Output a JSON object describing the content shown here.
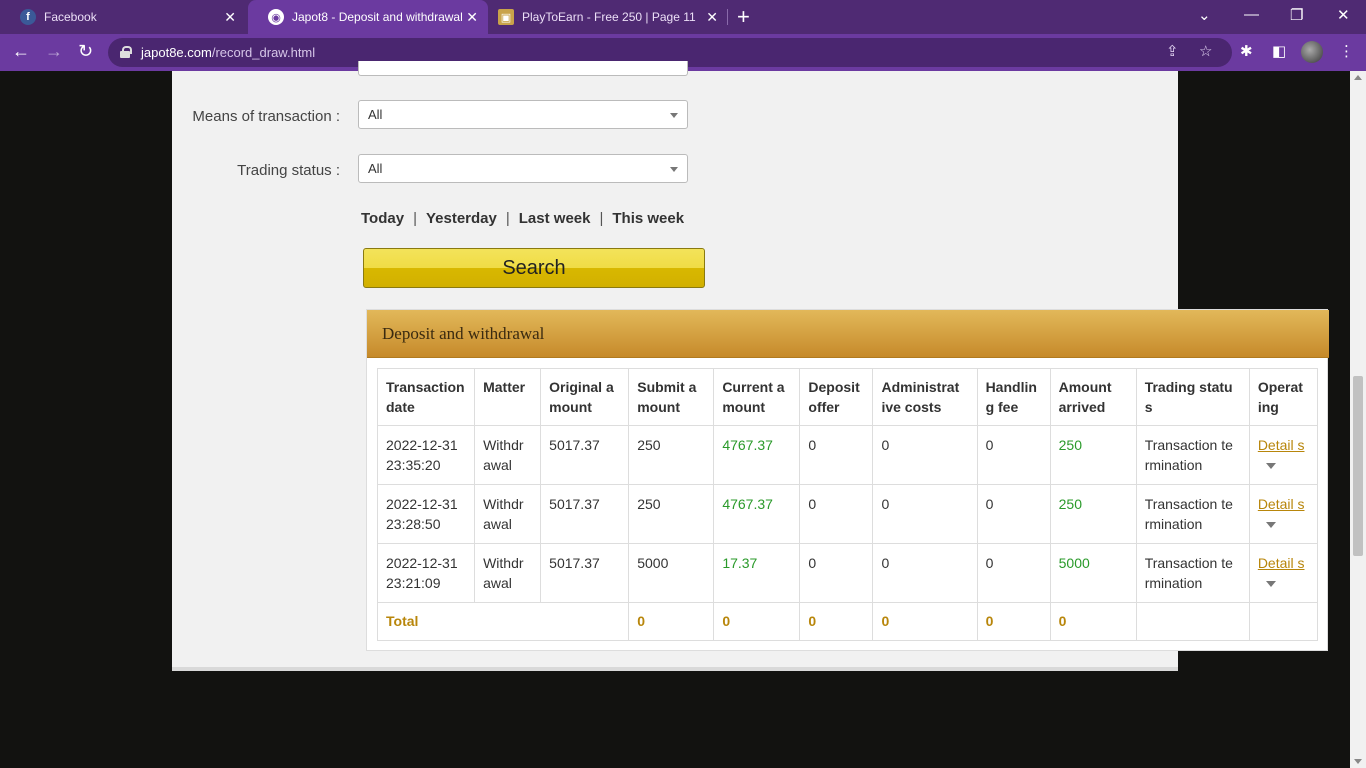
{
  "browser": {
    "tabs": [
      {
        "title": "Facebook",
        "icon": "facebook-icon"
      },
      {
        "title": "Japot8 - Deposit and withdrawal",
        "icon": "globe-icon"
      },
      {
        "title": "PlayToEarn - Free 250 | Page 11 | I",
        "icon": "cube-icon"
      }
    ],
    "url_host": "japot8e.com",
    "url_path": "/record_draw.html"
  },
  "filters": {
    "means_label": "Means of transaction :",
    "means_value": "All",
    "status_label": "Trading status :",
    "status_value": "All"
  },
  "quick_ranges": [
    "Today",
    "Yesterday",
    "Last week",
    "This week"
  ],
  "search_label": "Search",
  "section_title": "Deposit and withdrawal",
  "table": {
    "headers": [
      "Transaction date",
      "Matter",
      "Original a mount",
      "Submit a mount",
      "Current a mount",
      "Deposit offer",
      "Administrat ive costs",
      "Handlin g fee",
      "Amount arrived",
      "Trading statu s",
      "Operat ing"
    ],
    "rows": [
      {
        "date": "2022-12-31",
        "time": "23:35:20",
        "matter": "Withdr awal",
        "original": "5017.37",
        "submit": "250",
        "current": "4767.37",
        "deposit_offer": "0",
        "admin": "0",
        "fee": "0",
        "arrived": "250",
        "status": "Transaction te rmination",
        "op": "Detail s"
      },
      {
        "date": "2022-12-31",
        "time": "23:28:50",
        "matter": "Withdr awal",
        "original": "5017.37",
        "submit": "250",
        "current": "4767.37",
        "deposit_offer": "0",
        "admin": "0",
        "fee": "0",
        "arrived": "250",
        "status": "Transaction te rmination",
        "op": "Detail s"
      },
      {
        "date": "2022-12-31",
        "time": "23:21:09",
        "matter": "Withdr awal",
        "original": "5017.37",
        "submit": "5000",
        "current": "17.37",
        "deposit_offer": "0",
        "admin": "0",
        "fee": "0",
        "arrived": "5000",
        "status": "Transaction te rmination",
        "op": "Detail s"
      }
    ],
    "total": {
      "label": "Total",
      "submit": "0",
      "current": "0",
      "deposit_offer": "0",
      "admin": "0",
      "fee": "0",
      "arrived": "0"
    }
  },
  "colors": {
    "accent_purple": "#6b3aa0",
    "header_gold": "#d4a040",
    "green_value": "#2a9a2a",
    "link_gold": "#b8860b"
  }
}
